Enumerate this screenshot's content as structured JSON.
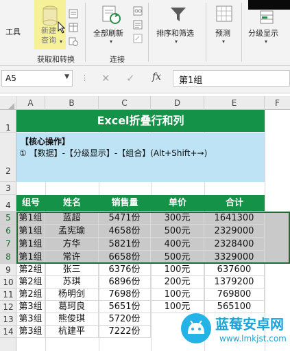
{
  "ribbon": {
    "items": [
      {
        "label": "工具",
        "icon": "tools-icon"
      },
      {
        "label": "新建\n查询",
        "icon": "new-query-icon"
      },
      {
        "label": "全部刷新",
        "icon": "refresh-all-icon"
      },
      {
        "label": "排序和筛选",
        "icon": "filter-icon"
      },
      {
        "label": "预测",
        "icon": "forecast-icon"
      },
      {
        "label": "分级显示",
        "icon": "outline-icon"
      }
    ],
    "groups": [
      "获取和转换",
      "连接"
    ]
  },
  "formula_bar": {
    "name_box": "A5",
    "formula": "第1组"
  },
  "columns": [
    "A",
    "B",
    "C",
    "D",
    "E",
    "F"
  ],
  "rows": [
    "1",
    "2",
    "3",
    "4",
    "5",
    "6",
    "7",
    "8",
    "9",
    "10",
    "11",
    "12",
    "13",
    "14"
  ],
  "sheet": {
    "title": "Excel折叠行和列",
    "instruction_title": "【核心操作】",
    "instruction_body": "① 【数据】-【分级显示】-【组合】(Alt+Shift+→)",
    "headers": [
      "组号",
      "姓名",
      "销售量",
      "单价",
      "合计"
    ],
    "table": [
      [
        "第1组",
        "蓝超",
        "5471份",
        "300元",
        "1641300"
      ],
      [
        "第1组",
        "孟宪瑜",
        "4658份",
        "500元",
        "2329000"
      ],
      [
        "第1组",
        "方华",
        "5821份",
        "400元",
        "2328400"
      ],
      [
        "第1组",
        "常许",
        "6658份",
        "500元",
        "3329000"
      ],
      [
        "第2组",
        "张三",
        "6376份",
        "100元",
        "637600"
      ],
      [
        "第2组",
        "苏琪",
        "6896份",
        "200元",
        "1379200"
      ],
      [
        "第2组",
        "杨明剑",
        "7698份",
        "100元",
        "769800"
      ],
      [
        "第3组",
        "葛珂良",
        "5651份",
        "100元",
        "565100"
      ],
      [
        "第3组",
        "熊俊琪",
        "5720份",
        "",
        ""
      ],
      [
        "第3组",
        "杭建平",
        "7222份",
        "",
        ""
      ]
    ]
  },
  "watermark": {
    "name": "蓝莓安卓网",
    "url": "www.lmkjst.com"
  },
  "colors": {
    "header_green": "#149247",
    "instruction_blue": "#bde3f5",
    "selection_gray": "#c9c9c9",
    "highlight_yellow": "#f6f099"
  }
}
